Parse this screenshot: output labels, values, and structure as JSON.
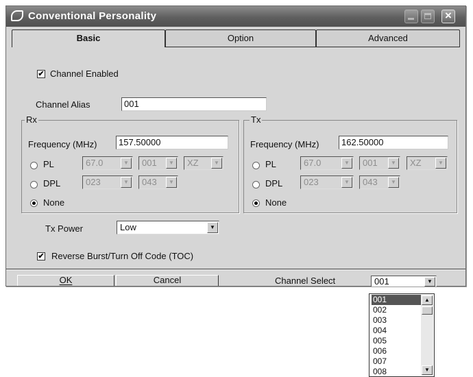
{
  "window": {
    "title": "Conventional Personality"
  },
  "tabs": [
    {
      "label": "Basic"
    },
    {
      "label": "Option"
    },
    {
      "label": "Advanced"
    }
  ],
  "basic": {
    "channel_enabled": {
      "label": "Channel Enabled",
      "checked": true
    },
    "channel_alias": {
      "label": "Channel Alias",
      "value": "001"
    },
    "rx": {
      "group_label": "Rx",
      "frequency_label": "Frequency (MHz)",
      "frequency_value": "157.50000",
      "pl_label": "PL",
      "pl_values": [
        "67.0",
        "001",
        "XZ"
      ],
      "dpl_label": "DPL",
      "dpl_values": [
        "023",
        "043"
      ],
      "none_label": "None",
      "selected_mode": "None"
    },
    "tx": {
      "group_label": "Tx",
      "frequency_label": "Frequency (MHz)",
      "frequency_value": "162.50000",
      "pl_label": "PL",
      "pl_values": [
        "67.0",
        "001",
        "XZ"
      ],
      "dpl_label": "DPL",
      "dpl_values": [
        "023",
        "043"
      ],
      "none_label": "None",
      "selected_mode": "None"
    },
    "tx_power": {
      "label": "Tx Power",
      "value": "Low"
    },
    "reverse_burst": {
      "label": "Reverse Burst/Turn Off Code (TOC)",
      "checked": true
    }
  },
  "footer": {
    "ok_label": "OK",
    "cancel_label": "Cancel",
    "channel_select_label": "Channel Select",
    "channel_select_value": "001",
    "channel_options": [
      "001",
      "002",
      "003",
      "004",
      "005",
      "006",
      "007",
      "008"
    ],
    "selected_option": "001"
  },
  "icons": {
    "check": "✔",
    "dropdown": "▼",
    "scroll_up": "▲",
    "scroll_down": "▼",
    "close": "×"
  },
  "colors": {
    "titlebar": "#5f5f5f",
    "dialog_bg": "#d6d6d6",
    "selection": "#555555"
  }
}
